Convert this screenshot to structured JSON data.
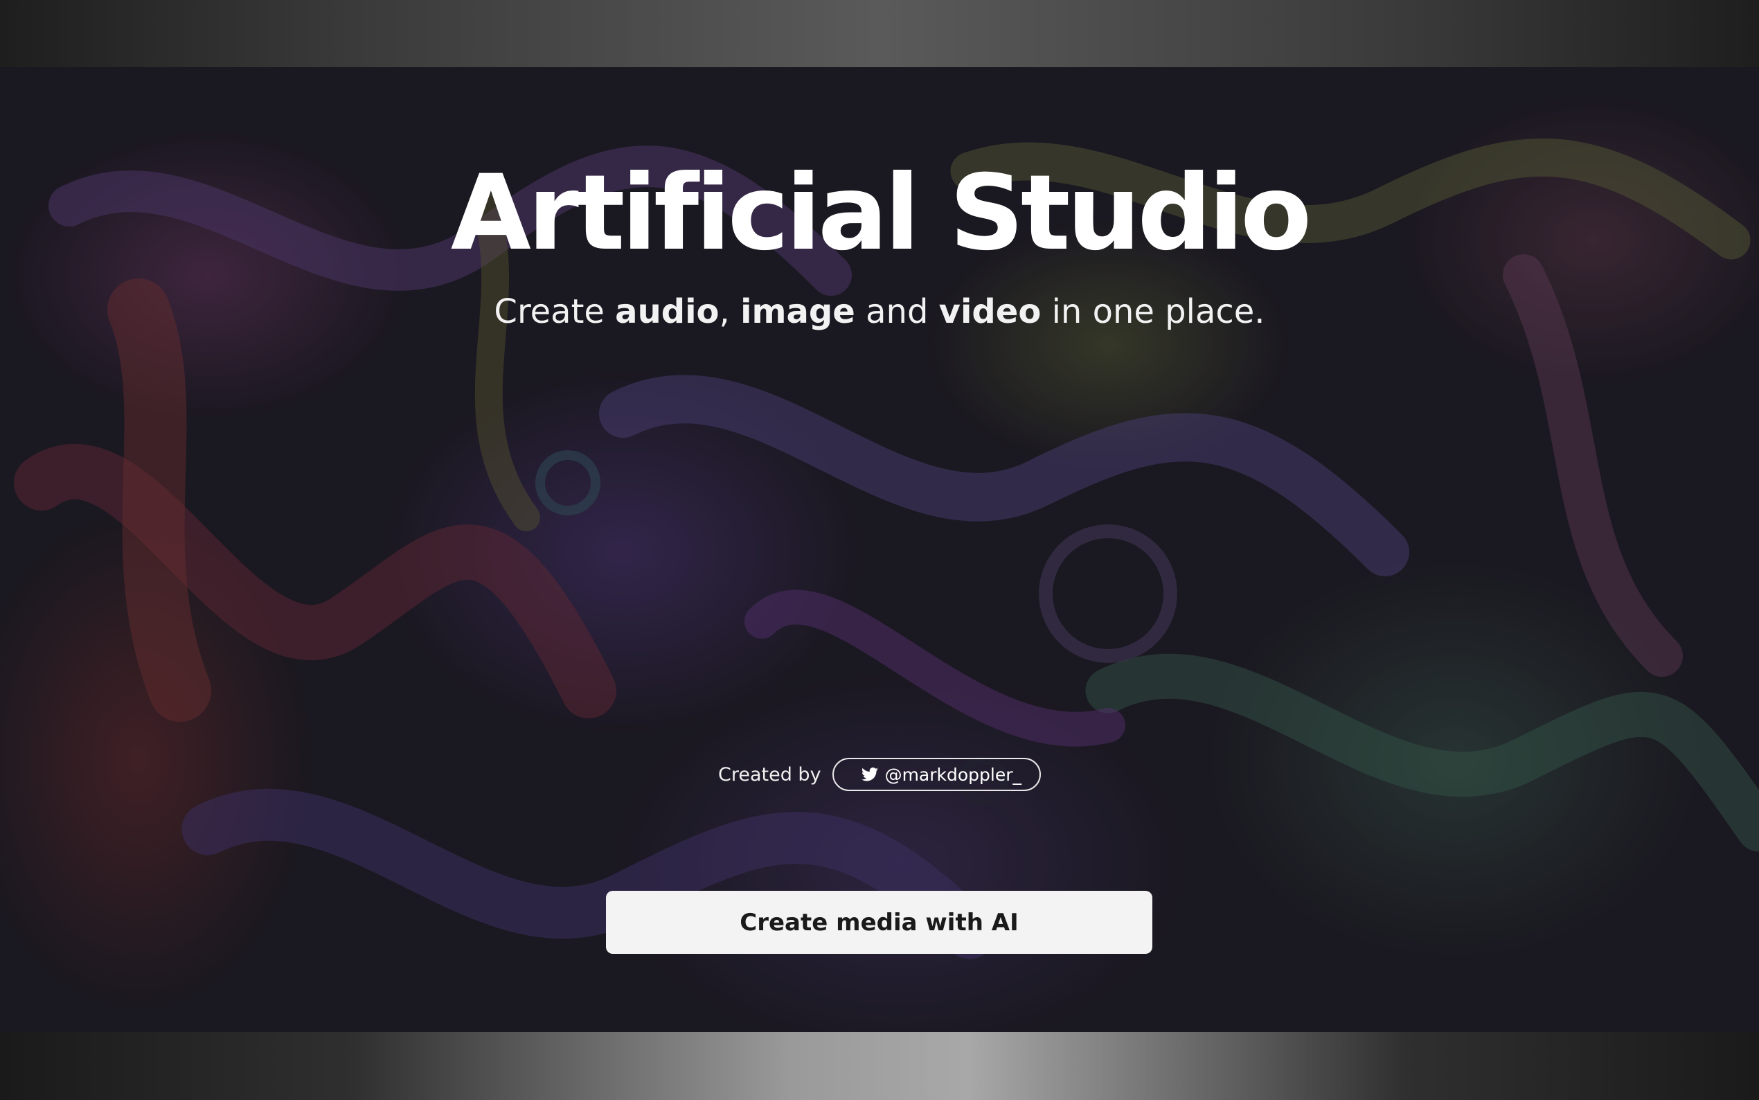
{
  "hero": {
    "title": "Artificial Studio",
    "subtitle": {
      "prefix": "Create ",
      "audio": "audio",
      "comma": ",",
      "image": "image",
      "and": " and ",
      "video": "video",
      "suffix": " in one place."
    }
  },
  "credit": {
    "label": "Created by",
    "twitter_handle": "@markdoppler_",
    "icon": "twitter-bird-icon"
  },
  "cta": {
    "label": "Create media with AI"
  },
  "colors": {
    "title_text": "#ffffff",
    "cta_background": "#f3f3f3",
    "cta_text": "#1a1a1a",
    "page_background": "#1f1c26"
  }
}
